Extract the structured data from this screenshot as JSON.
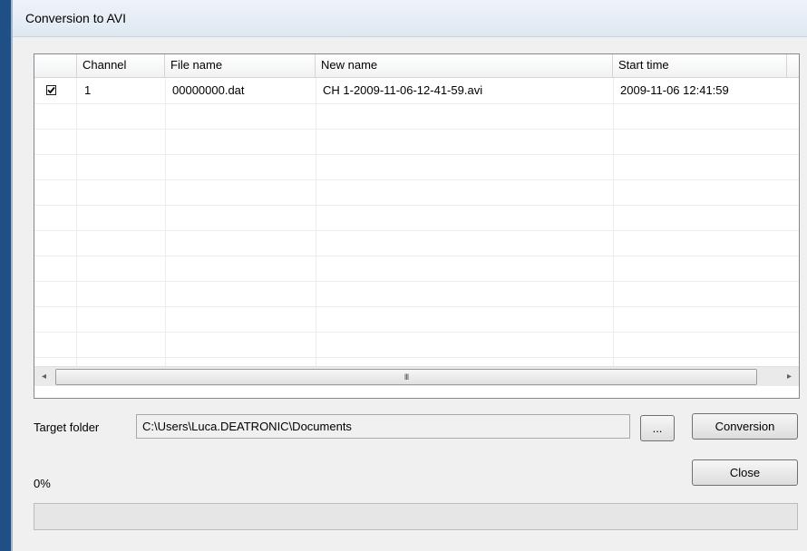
{
  "window": {
    "title": "Conversion to AVI"
  },
  "table": {
    "columns": [
      "",
      "Channel",
      "File name",
      "New name",
      "Start time"
    ],
    "rows": [
      {
        "checked": true,
        "channel": "1",
        "file_name": "00000000.dat",
        "new_name": "CH 1-2009-11-06-12-41-59.avi",
        "start_time": "2009-11-06 12:41:59"
      }
    ],
    "scrollbar": {
      "left_arrow": "◂",
      "right_arrow": "▸",
      "grip": "III"
    }
  },
  "target_folder": {
    "label": "Target folder",
    "path": "C:\\Users\\Luca.DEATRONIC\\Documents",
    "browse_label": "..."
  },
  "buttons": {
    "conversion": "Conversion",
    "close": "Close"
  },
  "progress": {
    "text": "0%",
    "value": 0
  },
  "colors": {
    "progress_fill": "#06b025",
    "titlebar": "#dfe8f2"
  }
}
